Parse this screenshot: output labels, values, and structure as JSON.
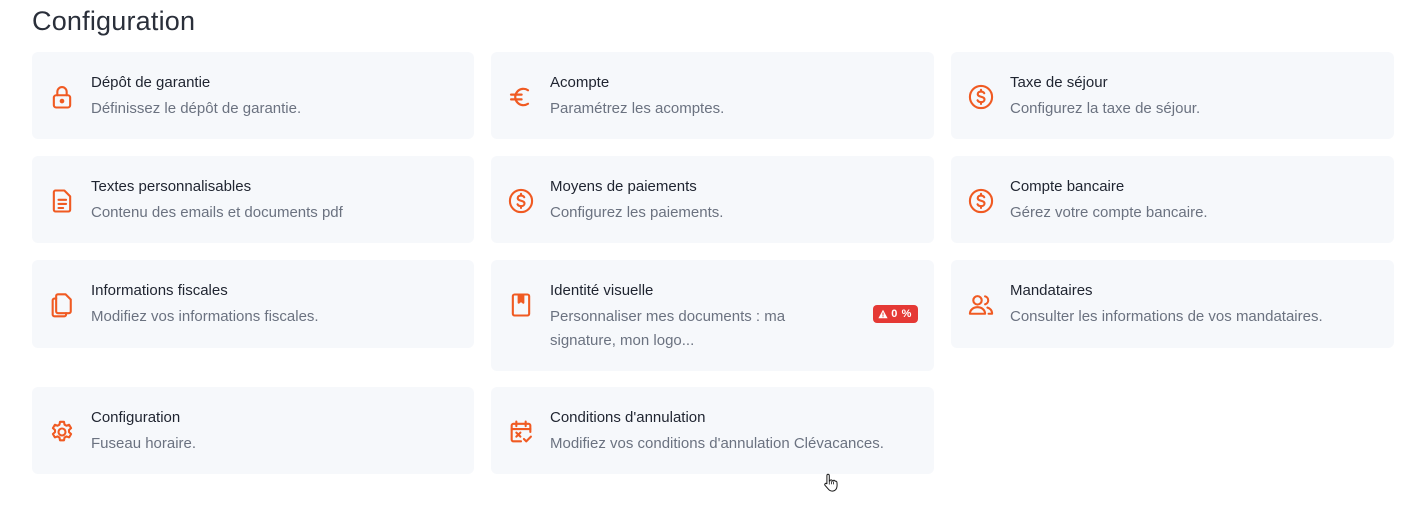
{
  "page": {
    "title": "Configuration"
  },
  "accent_color": "#f05a22",
  "badge_color": "#e53935",
  "cards": [
    {
      "title": "Dépôt de garantie",
      "description": "Définissez le dépôt de garantie.",
      "icon": "lock-icon"
    },
    {
      "title": "Acompte",
      "description": "Paramétrez les acomptes.",
      "icon": "euro-icon"
    },
    {
      "title": "Taxe de séjour",
      "description": "Configurez la taxe de séjour.",
      "icon": "dollar-circle-icon"
    },
    {
      "title": "Textes personnalisables",
      "description": "Contenu des emails et documents pdf",
      "icon": "document-text-icon"
    },
    {
      "title": "Moyens de paiements",
      "description": "Configurez les paiements.",
      "icon": "dollar-circle-icon"
    },
    {
      "title": "Compte bancaire",
      "description": "Gérez votre compte bancaire.",
      "icon": "dollar-circle-icon"
    },
    {
      "title": "Informations fiscales",
      "description": "Modifiez vos informations fiscales.",
      "icon": "documents-copy-icon"
    },
    {
      "title": "Identité visuelle",
      "description": "Personnaliser mes documents : ma signature, mon logo...",
      "icon": "bookmark-book-icon",
      "badge": "0 %",
      "badge_icon": "warning-triangle-icon"
    },
    {
      "title": "Mandataires",
      "description": "Consulter les informations de vos mandataires.",
      "icon": "users-icon"
    },
    {
      "title": "Configuration",
      "description": "Fuseau horaire.",
      "icon": "gear-icon"
    },
    {
      "title": "Conditions d'annulation",
      "description": "Modifiez vos conditions d'annulation Clévacances.",
      "icon": "calendar-cancel-icon"
    }
  ]
}
